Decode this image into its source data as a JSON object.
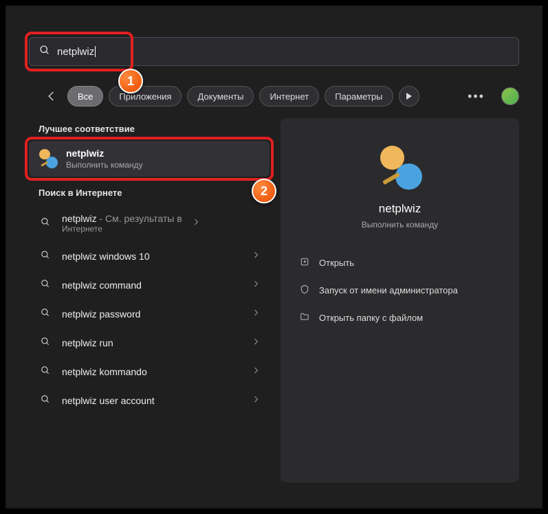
{
  "search": {
    "value": "netplwiz"
  },
  "filters": {
    "items": [
      {
        "label": "Все",
        "active": true
      },
      {
        "label": "Приложения",
        "active": false
      },
      {
        "label": "Документы",
        "active": false
      },
      {
        "label": "Интернет",
        "active": false
      },
      {
        "label": "Параметры",
        "active": false
      }
    ]
  },
  "sections": {
    "best_match": "Лучшее соответствие",
    "web_search": "Поиск в Интернете"
  },
  "best": {
    "title": "netplwiz",
    "subtitle": "Выполнить команду"
  },
  "web": {
    "first": {
      "prefix": "netplwiz",
      "dash": " - ",
      "suffix": "См. результаты в",
      "line2": "Интернете"
    },
    "items": [
      "netplwiz windows 10",
      "netplwiz command",
      "netplwiz password",
      "netplwiz run",
      "netplwiz kommando",
      "netplwiz user account"
    ]
  },
  "panel": {
    "title": "netplwiz",
    "subtitle": "Выполнить команду",
    "actions": [
      {
        "icon": "open",
        "label": "Открыть"
      },
      {
        "icon": "admin",
        "label": "Запуск от имени администратора"
      },
      {
        "icon": "folder",
        "label": "Открыть папку с файлом"
      }
    ]
  },
  "markers": {
    "one": "1",
    "two": "2"
  }
}
